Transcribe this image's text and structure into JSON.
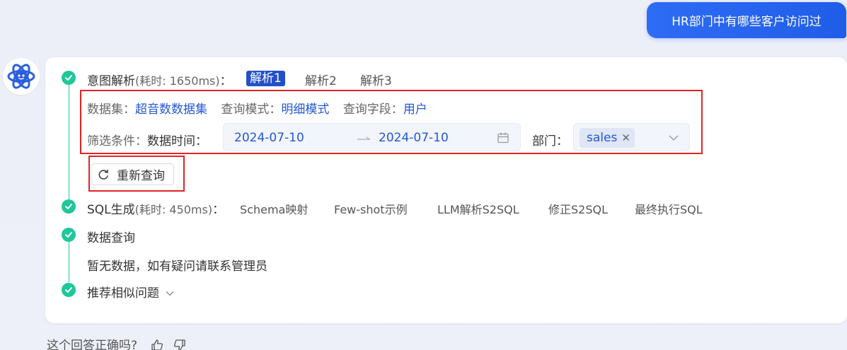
{
  "user_message": "HR部门中有哪些客户访问过",
  "intent": {
    "title": "意图解析",
    "time": "(耗时: 1650ms)",
    "colon": "：",
    "tabs": [
      "解析1",
      "解析2",
      "解析3"
    ],
    "dataset_label": "数据集：",
    "dataset_value": "超音数数据集",
    "mode_label": "查询模式：",
    "mode_value": "明细模式",
    "field_label": "查询字段：",
    "field_value": "用户",
    "filter_label": "筛选条件：",
    "time_label": "数据时间：",
    "date_start": "2024-07-10",
    "date_end": "2024-07-10",
    "dept_label": "部门：",
    "dept_tag": "sales",
    "requery_label": "重新查询"
  },
  "sql": {
    "title": "SQL生成",
    "time": "(耗时: 450ms)",
    "colon": "：",
    "steps": [
      "Schema映射",
      "Few-shot示例",
      "LLM解析S2SQL",
      "修正S2SQL",
      "最终执行SQL"
    ]
  },
  "query": {
    "title": "数据查询",
    "empty_text": "暂无数据，如有疑问请联系管理员"
  },
  "recommend": {
    "title": "推荐相似问题"
  },
  "feedback": {
    "question": "这个回答正确吗?"
  },
  "colors": {
    "accent": "#2350c8",
    "success": "#1fc79a",
    "highlight_border": "#e02424"
  }
}
